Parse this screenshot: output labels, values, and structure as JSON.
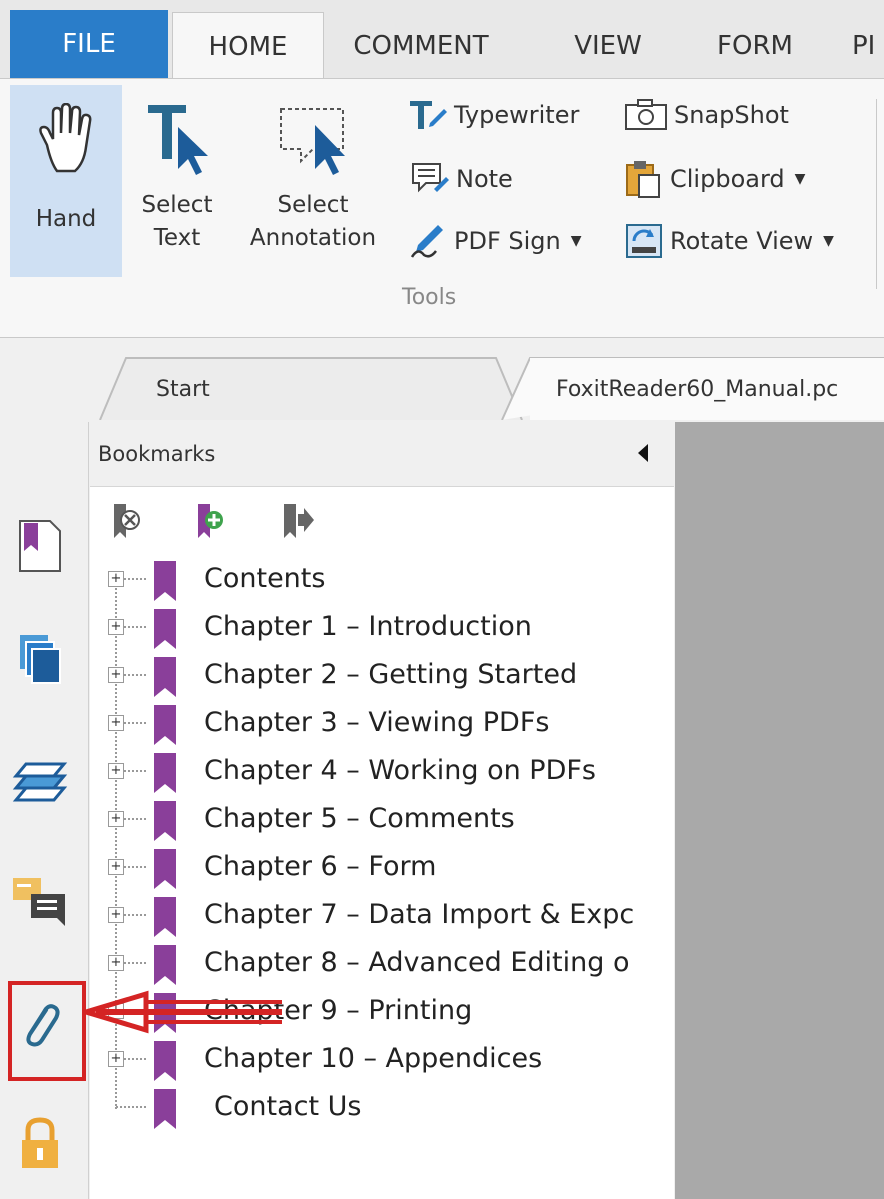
{
  "ribbon_tabs": [
    "FILE",
    "HOME",
    "COMMENT",
    "VIEW",
    "FORM",
    "PI"
  ],
  "ribbon": {
    "hand": "Hand",
    "select_text": [
      "Select",
      "Text"
    ],
    "select_annotation": [
      "Select",
      "Annotation"
    ],
    "typewriter": "Typewriter",
    "note": "Note",
    "pdf_sign": "PDF Sign",
    "snapshot": "SnapShot",
    "clipboard": "Clipboard",
    "rotate_view": "Rotate View",
    "group_label": "Tools"
  },
  "doc_tabs": {
    "start": "Start",
    "manual": "FoxitReader60_Manual.pc"
  },
  "panel": {
    "title": "Bookmarks"
  },
  "bookmarks": [
    "Contents",
    "Chapter 1 – Introduction",
    "Chapter 2 – Getting Started",
    "Chapter 3 – Viewing PDFs",
    "Chapter 4 – Working on PDFs",
    "Chapter 5 – Comments",
    "Chapter 6 – Form",
    "Chapter 7 – Data Import & Expc",
    "Chapter 8 – Advanced Editing o",
    "Chapter 9 – Printing",
    "Chapter 10 – Appendices",
    "Contact Us"
  ],
  "colors": {
    "accent_blue": "#2a7dc9",
    "bookmark_purple": "#8a3f9a",
    "callout_red": "#d42424"
  }
}
